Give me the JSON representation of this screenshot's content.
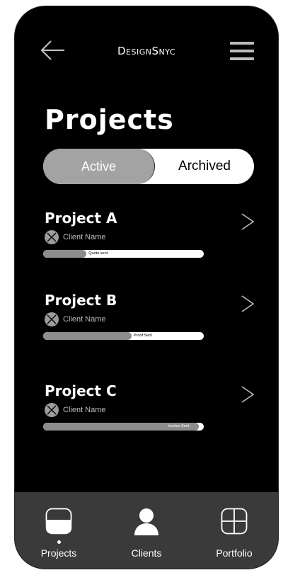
{
  "header": {
    "brand": "DesignSnyc",
    "back_icon": "back-arrow-icon",
    "menu_icon": "hamburger-menu-icon"
  },
  "page": {
    "title": "Projects"
  },
  "segments": {
    "active_label": "Active",
    "archived_label": "Archived",
    "selected": "Active"
  },
  "projects": [
    {
      "name": "Project A",
      "client": "Client Name",
      "status": "Quote sent",
      "progress": 0.27
    },
    {
      "name": "Project B",
      "client": "Client Name",
      "status": "Proof Sent",
      "progress": 0.55
    },
    {
      "name": "Project C",
      "client": "Client Name",
      "status": "Invoice Sent",
      "progress": 0.97
    }
  ],
  "tabbar": {
    "items": [
      {
        "label": "Projects",
        "icon": "projects-icon",
        "selected": true
      },
      {
        "label": "Clients",
        "icon": "user-icon",
        "selected": false
      },
      {
        "label": "Portfolio",
        "icon": "portfolio-grid-icon",
        "selected": false
      }
    ]
  },
  "colors": {
    "background": "#000000",
    "segment_active": "#a3a3a3",
    "progress_fill": "#8c8c8c",
    "tabbar": "#3a3a3a"
  }
}
